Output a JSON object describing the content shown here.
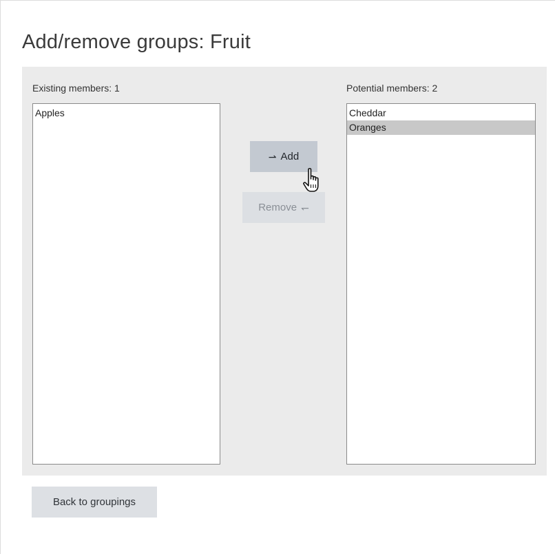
{
  "page": {
    "title": "Add/remove groups: Fruit"
  },
  "existing": {
    "label": "Existing members: 1",
    "options": [
      "Apples"
    ]
  },
  "potential": {
    "label": "Potential members: 2",
    "options": [
      "Cheddar",
      "Oranges"
    ],
    "selected": "Oranges"
  },
  "buttons": {
    "add_arrow": "⇀",
    "add_label": "Add",
    "remove_label": "Remove",
    "remove_arrow": "↽",
    "back_label": "Back to groupings"
  },
  "icons": {
    "cursor": "hand-pointer-icon"
  },
  "colors": {
    "panel_bg": "#ebebeb",
    "selected_option_bg": "#c8c8c8",
    "add_button_bg": "#c3c9d1",
    "disabled_button_bg": "#dcdfe3"
  }
}
